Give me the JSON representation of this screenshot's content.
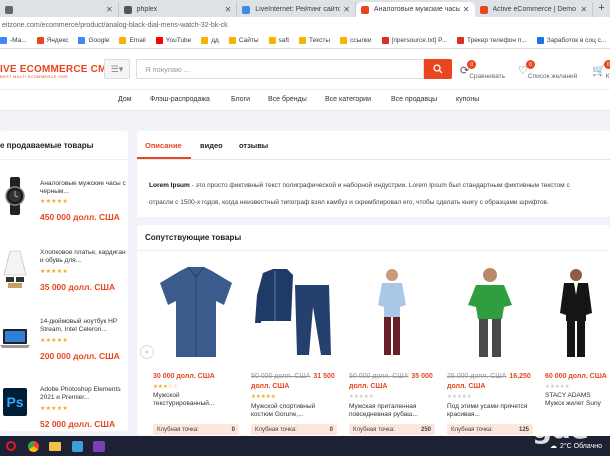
{
  "browser": {
    "tabs": [
      {
        "label": "",
        "color": "#666666",
        "active": false
      },
      {
        "label": "phplex",
        "color": "#555555",
        "active": false
      },
      {
        "label": "LiveInternet: Рейтинг сайтов",
        "color": "#3b8de0",
        "active": false
      },
      {
        "label": "Аналоговые мужские часы с че",
        "color": "#e8461f",
        "active": true
      },
      {
        "label": "Active eCommerce | Demo of Ac",
        "color": "#e8461f",
        "active": false
      }
    ],
    "new_tab": "+",
    "url": "eitzone.com/ecommerce/product/analog-black-dial-mens-watch-32-bk-ck",
    "bookmarks": [
      {
        "label": "-Ma...",
        "color": "#4285f4"
      },
      {
        "label": "Яндекс",
        "color": "#e8461f"
      },
      {
        "label": "Google",
        "color": "#4285f4"
      },
      {
        "label": "Email",
        "color": "#f4b400"
      },
      {
        "label": "YouTube",
        "color": "#ff0000"
      },
      {
        "label": "дд",
        "color": "#f4b400"
      },
      {
        "label": "Сайты",
        "color": "#f4b400"
      },
      {
        "label": "saft",
        "color": "#f4b400"
      },
      {
        "label": "Тексты",
        "color": "#f4b400"
      },
      {
        "label": "ссылки",
        "color": "#f4b400"
      },
      {
        "label": "[ripersource.txt] P...",
        "color": "#d93025"
      },
      {
        "label": "Трекeр телефон п...",
        "color": "#d93025"
      },
      {
        "label": "Заработок в соц с...",
        "color": "#1a73e8"
      }
    ]
  },
  "header": {
    "logo_main": "IVE ECOMMERCE CMS",
    "logo_sub": "BEST MULTI ECOMMERCE CMS",
    "search_placeholder": "Я покупаю ...",
    "compare_label": "Сравнивать",
    "compare_count": "0",
    "wishlist_label": "Список желаний",
    "wishlist_count": "0",
    "cart_count": "0",
    "cart_label": "К"
  },
  "nav": [
    "Дом",
    "Флэш-распродажа",
    "Блоги",
    "Все бренды",
    "Все категории",
    "Все продавцы",
    "купоны"
  ],
  "bestsellers": {
    "title": "е продаваемые товары",
    "items": [
      {
        "name": "Аналоговые мужские часы с черным...",
        "stars": "★★★★★",
        "price": "450 000 долл. США"
      },
      {
        "name": "Хлопковое платье, кардиган и обувь для...",
        "stars": "★★★★★",
        "price": "35 000 долл. США"
      },
      {
        "name": "14-дюймовый ноутбук HP Stream, Intel Celeron...",
        "stars": "★★★★★",
        "price": "200 000 долл. США"
      },
      {
        "name": "Adobe Photoshop Elements 2021 и Premier...",
        "stars": "★★★★★",
        "price": "52 000 долл. США"
      }
    ]
  },
  "description": {
    "tabs": [
      "Описание",
      "видео",
      "отзывы"
    ],
    "bold": "Lorem Ipsum",
    "line1": " - это просто фиктивный текст полиграфической и наборной индустрии. Lorem Ipsum был стандартным фиктивным текстом с",
    "line2": "отрасли с 1500-х годов, когда неизвестный типограф взял камбуз и скремблировал его, чтобы сделать книгу с образцами шрифтов."
  },
  "related": {
    "title": "Сопутствующие товары",
    "club_label": "Клубная точка:",
    "items": [
      {
        "old": "",
        "price": "30 000 долл. США",
        "stars": "★★★☆☆",
        "gray": false,
        "name": "Мужской текстурированный...",
        "points": "0"
      },
      {
        "old": "50 000 долл. США",
        "price": "31 500 долл. США",
        "stars": "★★★★★",
        "gray": false,
        "name": "Мужской спортивный костюм Gorune,...",
        "points": "0"
      },
      {
        "old": "50 000 долл. США",
        "price": "35 000 долл. США",
        "stars": "★★★★★",
        "gray": true,
        "name": "Мужская приталенная повседневная рубаш...",
        "points": "250"
      },
      {
        "old": "25 000 долл. США",
        "price": "16,250 долл. США",
        "stars": "★★★★★",
        "gray": true,
        "name": "Под этими усами прячется красивая...",
        "points": "125"
      },
      {
        "old": "",
        "price": "60 000 долл. США",
        "stars": "★★★★★",
        "gray": true,
        "name": "STACY ADAMS Мужск жилет Suny",
        "points": ""
      }
    ]
  },
  "taskbar": {
    "weather": "2°C Облачно",
    "watermark": "gde"
  }
}
